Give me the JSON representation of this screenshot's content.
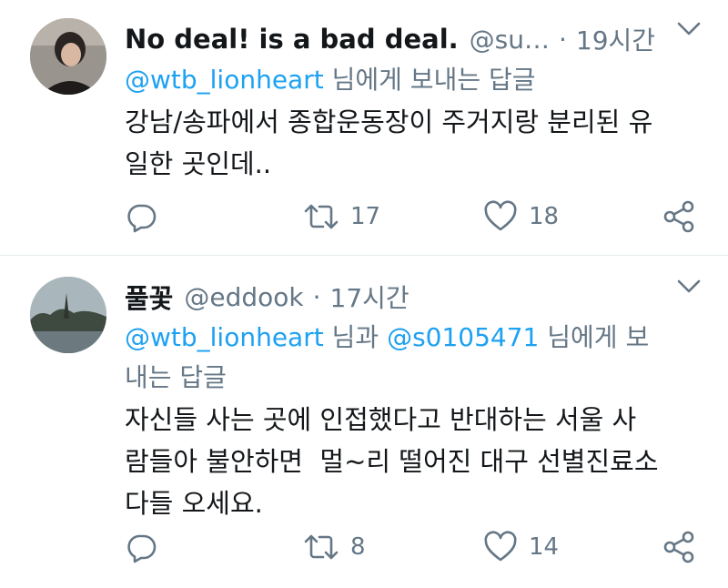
{
  "tweets": [
    {
      "name": "No deal! is a bad deal.",
      "handle": "@su…",
      "separator": "·",
      "time": "19시간",
      "reply_mentions": [
        "@wtb_lionheart"
      ],
      "reply_joiner": "",
      "reply_suffix": "님에게 보내는 답글",
      "text_lines": [
        "강남/송파에서 종합운동장이 주거지랑 분리된 유",
        "일한 곳인데.."
      ],
      "retweets": "17",
      "likes": "18"
    },
    {
      "name": "풀꽃",
      "handle": "@eddook",
      "separator": "·",
      "time": "17시간",
      "reply_line1_mention1": "@wtb_lionheart",
      "reply_line1_joiner": "님과",
      "reply_line1_mention2": "@s0105471",
      "reply_line1_suffix": "님에게 보",
      "reply_line2": "내는 답글",
      "text_lines": [
        "자신들 사는 곳에 인접했다고 반대하는 서울 사",
        "람들아 불안하면  멀~리 떨어진 대구 선별진료소",
        "다들 오세요."
      ],
      "retweets": "8",
      "likes": "14"
    }
  ],
  "icons": {
    "menu": "chevron-down-icon",
    "reply": "reply-bubble-icon",
    "retweet": "retweet-icon",
    "like": "heart-icon",
    "share": "share-icon"
  },
  "colors": {
    "text": "#14171a",
    "secondary": "#657786",
    "link": "#1da1f2",
    "divider": "#e6ecf0"
  }
}
